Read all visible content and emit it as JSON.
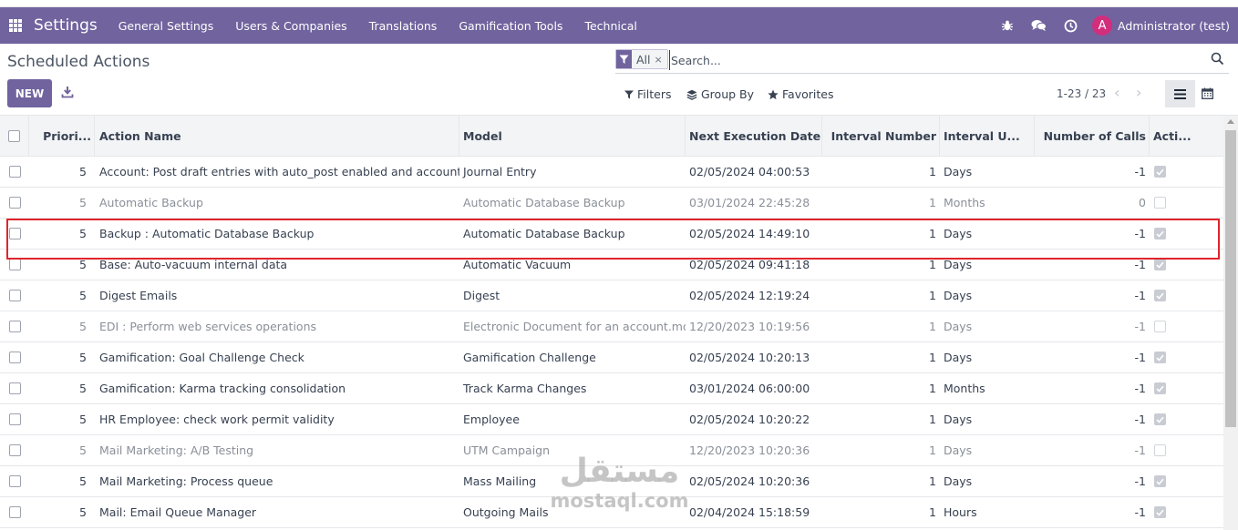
{
  "navbar": {
    "brand": "Settings",
    "menus": [
      "General Settings",
      "Users & Companies",
      "Translations",
      "Gamification Tools",
      "Technical"
    ],
    "icons": [
      "bug-icon",
      "chat-icon",
      "clock-icon"
    ],
    "avatar_letter": "A",
    "user": "Administrator (test)",
    "color": "#71639e"
  },
  "page": {
    "title": "Scheduled Actions",
    "new_label": "NEW"
  },
  "search": {
    "facet": "All",
    "facet_remove": "×",
    "placeholder": "Search..."
  },
  "controls": {
    "filters": "Filters",
    "group_by": "Group By",
    "favorites": "Favorites"
  },
  "pager": {
    "range": "1-23 / 23"
  },
  "table": {
    "headers": {
      "priority": "Priori...",
      "name": "Action Name",
      "model": "Model",
      "next_exec": "Next Execution Date",
      "interval_number": "Interval Number",
      "interval_unit": "Interval U...",
      "calls": "Number of Calls",
      "active": "Acti..."
    },
    "rows": [
      {
        "priority": "5",
        "name": "Account: Post draft entries with auto_post enabled and accounting...",
        "model": "Journal Entry",
        "next_exec": "02/05/2024 04:00:53",
        "interval_number": "1",
        "interval_unit": "Days",
        "calls": "-1",
        "active": true
      },
      {
        "priority": "5",
        "name": "Automatic Backup",
        "model": "Automatic Database Backup",
        "next_exec": "03/01/2024 22:45:28",
        "interval_number": "1",
        "interval_unit": "Months",
        "calls": "0",
        "active": false
      },
      {
        "priority": "5",
        "name": "Backup : Automatic Database Backup",
        "model": "Automatic Database Backup",
        "next_exec": "02/05/2024 14:49:10",
        "interval_number": "1",
        "interval_unit": "Days",
        "calls": "-1",
        "active": true
      },
      {
        "priority": "5",
        "name": "Base: Auto-vacuum internal data",
        "model": "Automatic Vacuum",
        "next_exec": "02/05/2024 09:41:18",
        "interval_number": "1",
        "interval_unit": "Days",
        "calls": "-1",
        "active": true
      },
      {
        "priority": "5",
        "name": "Digest Emails",
        "model": "Digest",
        "next_exec": "02/05/2024 12:19:24",
        "interval_number": "1",
        "interval_unit": "Days",
        "calls": "-1",
        "active": true
      },
      {
        "priority": "5",
        "name": "EDI : Perform web services operations",
        "model": "Electronic Document for an account.move",
        "next_exec": "12/20/2023 10:19:56",
        "interval_number": "1",
        "interval_unit": "Days",
        "calls": "-1",
        "active": false
      },
      {
        "priority": "5",
        "name": "Gamification: Goal Challenge Check",
        "model": "Gamification Challenge",
        "next_exec": "02/05/2024 10:20:13",
        "interval_number": "1",
        "interval_unit": "Days",
        "calls": "-1",
        "active": true
      },
      {
        "priority": "5",
        "name": "Gamification: Karma tracking consolidation",
        "model": "Track Karma Changes",
        "next_exec": "03/01/2024 06:00:00",
        "interval_number": "1",
        "interval_unit": "Months",
        "calls": "-1",
        "active": true
      },
      {
        "priority": "5",
        "name": "HR Employee: check work permit validity",
        "model": "Employee",
        "next_exec": "02/05/2024 10:20:22",
        "interval_number": "1",
        "interval_unit": "Days",
        "calls": "-1",
        "active": true
      },
      {
        "priority": "5",
        "name": "Mail Marketing: A/B Testing",
        "model": "UTM Campaign",
        "next_exec": "12/20/2023 10:20:36",
        "interval_number": "1",
        "interval_unit": "Days",
        "calls": "-1",
        "active": false
      },
      {
        "priority": "5",
        "name": "Mail Marketing: Process queue",
        "model": "Mass Mailing",
        "next_exec": "02/05/2024 10:20:36",
        "interval_number": "1",
        "interval_unit": "Days",
        "calls": "-1",
        "active": true
      },
      {
        "priority": "5",
        "name": "Mail: Email Queue Manager",
        "model": "Outgoing Mails",
        "next_exec": "02/04/2024 15:18:59",
        "interval_number": "1",
        "interval_unit": "Hours",
        "calls": "-1",
        "active": true
      }
    ]
  },
  "watermark": {
    "arabic": "مستقل",
    "latin": "mostaql.com"
  }
}
